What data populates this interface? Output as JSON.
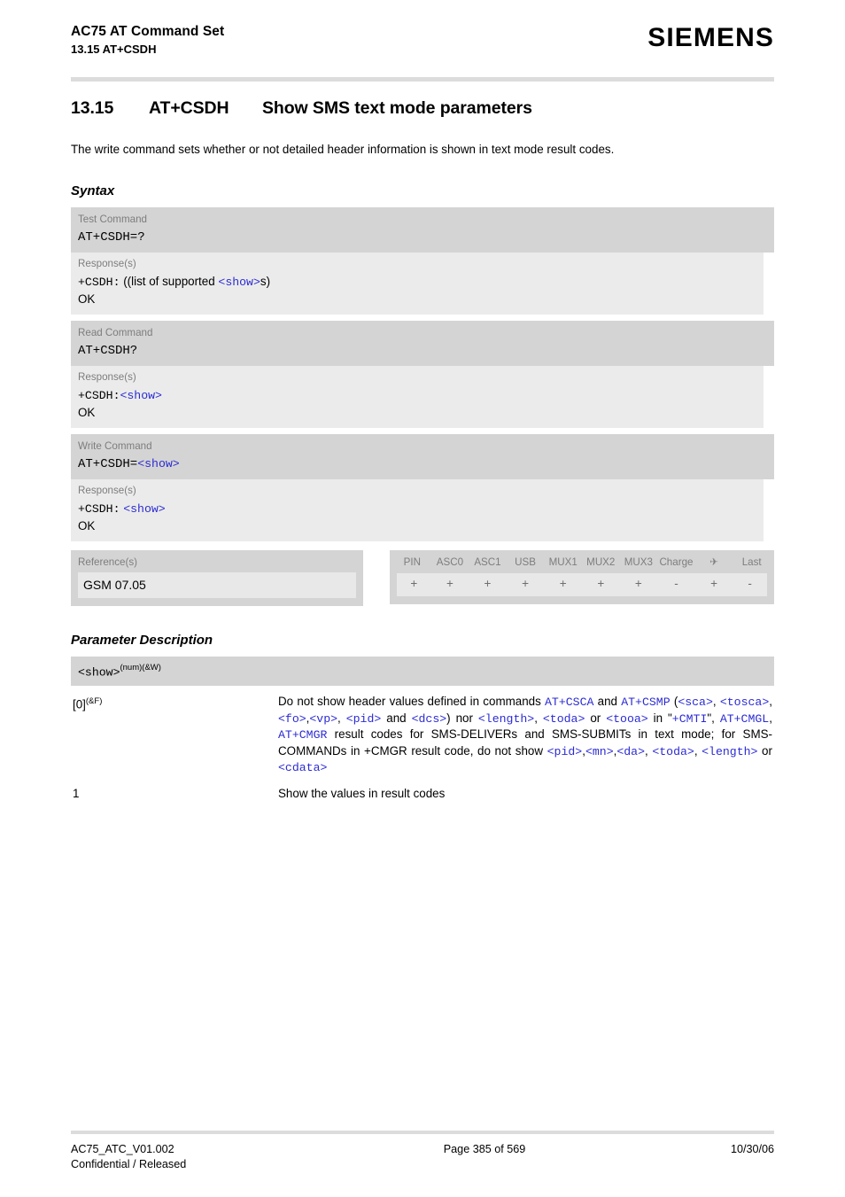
{
  "header": {
    "doc_title": "AC75 AT Command Set",
    "section": "13.15 AT+CSDH",
    "brand": "SIEMENS"
  },
  "title": {
    "number": "13.15",
    "command": "AT+CSDH",
    "description": "Show SMS text mode parameters"
  },
  "intro": "The write command sets whether or not detailed header information is shown in text mode result codes.",
  "sections": {
    "syntax": "Syntax",
    "parameter_description": "Parameter Description"
  },
  "syntax": {
    "test": {
      "label": "Test Command",
      "command": "AT+CSDH=?",
      "response_label": "Response(s)",
      "resp_prefix": "+CSDH:",
      "resp_text_before": "((list of supported",
      "resp_param": "<show>",
      "resp_text_after": "s)",
      "ok": "OK"
    },
    "read": {
      "label": "Read Command",
      "command": "AT+CSDH?",
      "response_label": "Response(s)",
      "resp_prefix": "+CSDH:",
      "resp_param": "<show>",
      "ok": "OK"
    },
    "write": {
      "label": "Write Command",
      "command_prefix": "AT+CSDH=",
      "command_param": "<show>",
      "response_label": "Response(s)",
      "resp_prefix": "+CSDH:",
      "resp_param": "<show>",
      "ok": "OK"
    },
    "reference": {
      "label": "Reference(s)",
      "value": "GSM 07.05"
    },
    "capabilities": {
      "columns": [
        "PIN",
        "ASC0",
        "ASC1",
        "USB",
        "MUX1",
        "MUX2",
        "MUX3",
        "Charge",
        "✈",
        "Last"
      ],
      "values": [
        "+",
        "+",
        "+",
        "+",
        "+",
        "+",
        "+",
        "-",
        "+",
        "-"
      ]
    }
  },
  "parameter": {
    "name": "<show>",
    "name_flags": "(num)(&W)",
    "rows": [
      {
        "key": "[0]",
        "key_flags": "(&F)",
        "desc_parts": [
          {
            "t": "Do not show header values defined in commands ",
            "k": "plain"
          },
          {
            "t": "AT+CSCA",
            "k": "link"
          },
          {
            "t": " and ",
            "k": "plain"
          },
          {
            "t": "AT+CSMP",
            "k": "link"
          },
          {
            "t": " (",
            "k": "plain"
          },
          {
            "t": "<sca>",
            "k": "link"
          },
          {
            "t": ", ",
            "k": "plain"
          },
          {
            "t": "<tosca>",
            "k": "link"
          },
          {
            "t": ",",
            "k": "plain"
          },
          {
            "t": "<fo>",
            "k": "link"
          },
          {
            "t": ",",
            "k": "plain"
          },
          {
            "t": "<vp>",
            "k": "link"
          },
          {
            "t": ", ",
            "k": "plain"
          },
          {
            "t": "<pid>",
            "k": "link"
          },
          {
            "t": " and ",
            "k": "plain"
          },
          {
            "t": "<dcs>",
            "k": "link"
          },
          {
            "t": ") nor ",
            "k": "plain"
          },
          {
            "t": "<length>",
            "k": "link"
          },
          {
            "t": ", ",
            "k": "plain"
          },
          {
            "t": "<toda>",
            "k": "link"
          },
          {
            "t": " or ",
            "k": "plain"
          },
          {
            "t": "<tooa>",
            "k": "link"
          },
          {
            "t": " in \"",
            "k": "plain"
          },
          {
            "t": "+CMTI",
            "k": "link"
          },
          {
            "t": "\", ",
            "k": "plain"
          },
          {
            "t": "AT+CMGL",
            "k": "link"
          },
          {
            "t": ", ",
            "k": "plain"
          },
          {
            "t": "AT+CMGR",
            "k": "link"
          },
          {
            "t": " result codes for SMS-DELIVERs and SMS-SUBMITs in text mode; for SMS-COMMANDs in +CMGR result code, do not show ",
            "k": "plain"
          },
          {
            "t": "<pid>",
            "k": "link"
          },
          {
            "t": ",",
            "k": "plain"
          },
          {
            "t": "<mn>",
            "k": "link"
          },
          {
            "t": ",",
            "k": "plain"
          },
          {
            "t": "<da>",
            "k": "link"
          },
          {
            "t": ", ",
            "k": "plain"
          },
          {
            "t": "<toda>",
            "k": "link"
          },
          {
            "t": ", ",
            "k": "plain"
          },
          {
            "t": "<length>",
            "k": "link"
          },
          {
            "t": " or ",
            "k": "plain"
          },
          {
            "t": "<cdata>",
            "k": "link"
          }
        ]
      },
      {
        "key": "1",
        "key_flags": "",
        "desc_parts": [
          {
            "t": "Show the values in result codes",
            "k": "plain"
          }
        ]
      }
    ]
  },
  "footer": {
    "doc_id": "AC75_ATC_V01.002",
    "page": "Page 385 of 569",
    "date": "10/30/06",
    "classification": "Confidential / Released"
  }
}
